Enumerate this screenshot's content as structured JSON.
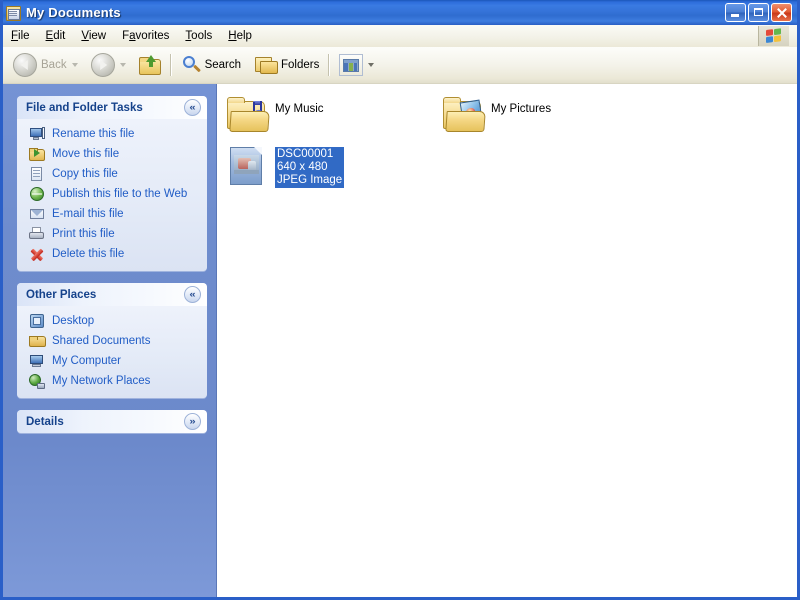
{
  "window": {
    "title": "My Documents",
    "icon": "documents-folder-icon",
    "controls": {
      "minimize": "Minimize",
      "maximize": "Maximize",
      "close": "Close"
    }
  },
  "menubar": {
    "items": [
      {
        "label": "File",
        "accel": "F"
      },
      {
        "label": "Edit",
        "accel": "E"
      },
      {
        "label": "View",
        "accel": "V"
      },
      {
        "label": "Favorites",
        "accel": "a"
      },
      {
        "label": "Tools",
        "accel": "T"
      },
      {
        "label": "Help",
        "accel": "H"
      }
    ],
    "logo": "windows-flag-logo"
  },
  "toolbar": {
    "back": "Back",
    "forward": "",
    "up": "",
    "search": "Search",
    "folders": "Folders",
    "views": ""
  },
  "sidebar": {
    "panels": [
      {
        "title": "File and Folder Tasks",
        "collapse_glyph": "«",
        "collapsed": false,
        "items": [
          {
            "label": "Rename this file",
            "icon": "rename-icon"
          },
          {
            "label": "Move this file",
            "icon": "move-icon"
          },
          {
            "label": "Copy this file",
            "icon": "copy-icon"
          },
          {
            "label": "Publish this file to the Web",
            "icon": "publish-web-icon"
          },
          {
            "label": "E-mail this file",
            "icon": "email-icon"
          },
          {
            "label": "Print this file",
            "icon": "print-icon"
          },
          {
            "label": "Delete this file",
            "icon": "delete-icon"
          }
        ]
      },
      {
        "title": "Other Places",
        "collapse_glyph": "«",
        "collapsed": false,
        "items": [
          {
            "label": "Desktop",
            "icon": "desktop-icon"
          },
          {
            "label": "Shared Documents",
            "icon": "shared-documents-icon"
          },
          {
            "label": "My Computer",
            "icon": "my-computer-icon"
          },
          {
            "label": "My Network Places",
            "icon": "my-network-places-icon"
          }
        ]
      },
      {
        "title": "Details",
        "collapse_glyph": "»",
        "collapsed": true,
        "items": []
      }
    ]
  },
  "content": {
    "items": [
      {
        "name": "My Music",
        "type": "folder",
        "icon": "music-folder-icon",
        "selected": false,
        "lines": [
          "My Music"
        ]
      },
      {
        "name": "My Pictures",
        "type": "folder",
        "icon": "pictures-folder-icon",
        "selected": false,
        "lines": [
          "My Pictures"
        ]
      },
      {
        "name": "DSC00001",
        "type": "file",
        "icon": "jpeg-image-icon",
        "selected": true,
        "dimensions": "640 x 480",
        "filetype": "JPEG Image",
        "lines": [
          "DSC00001",
          "640 x 480",
          "JPEG Image"
        ]
      }
    ]
  },
  "colors": {
    "titlebar_blue": "#3573d8",
    "selection_blue": "#316ac5",
    "sidebar_blue": "#6e8ccd",
    "link_blue": "#215dc6",
    "panel_title_blue": "#15428b",
    "close_red": "#c9391a",
    "toolbar_beige": "#ece9d8"
  }
}
